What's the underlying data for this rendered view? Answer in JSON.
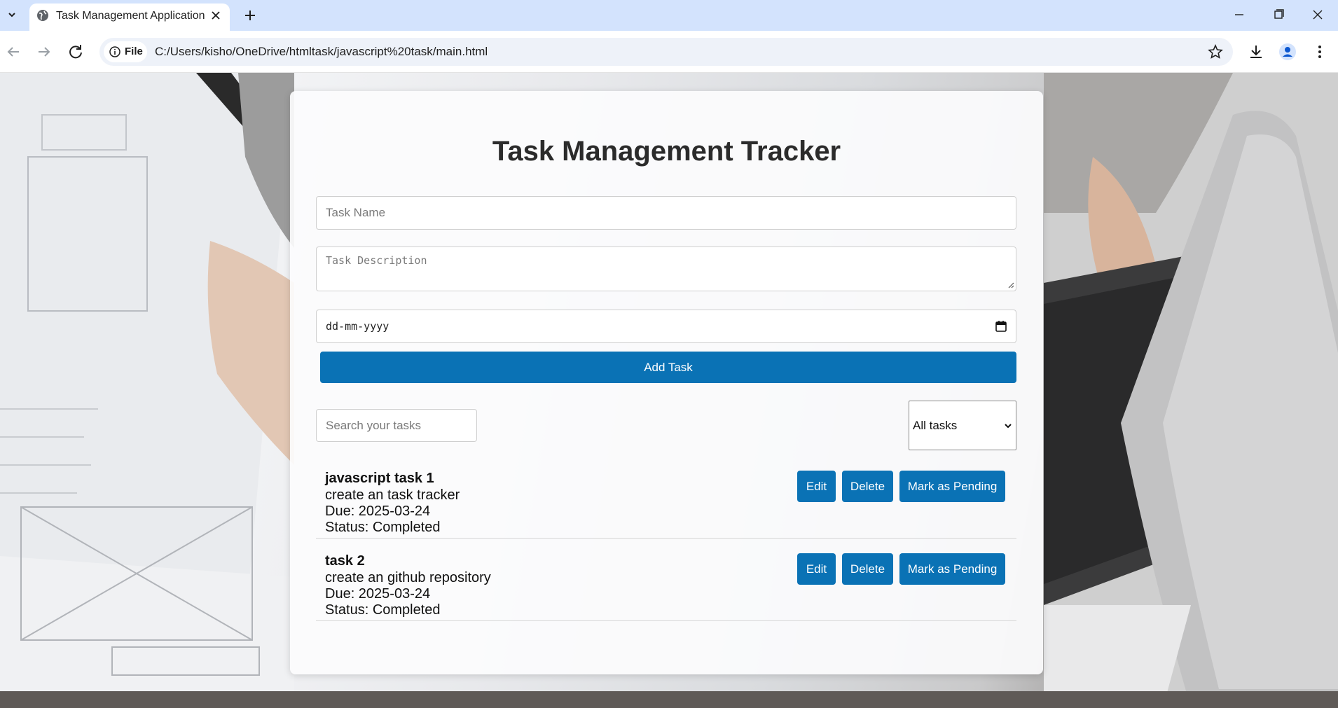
{
  "browser": {
    "tab_title": "Task Management Application",
    "chip_label": "File",
    "url": "C:/Users/kisho/OneDrive/htmltask/javascript%20task/main.html"
  },
  "page": {
    "title": "Task Management Tracker",
    "name_placeholder": "Task Name",
    "desc_placeholder": "Task Description",
    "date_value": "dd-mm-yyyy",
    "add_label": "Add Task",
    "search_placeholder": "Search your tasks",
    "filter_value": "All tasks"
  },
  "tasks": [
    {
      "name": "javascript task 1",
      "description": "create an task tracker",
      "due": "Due: 2025-03-24",
      "status": "Status: Completed",
      "edit_label": "Edit",
      "delete_label": "Delete",
      "toggle_label": "Mark as Pending"
    },
    {
      "name": "task 2",
      "description": "create an github repository",
      "due": "Due: 2025-03-24",
      "status": "Status: Completed",
      "edit_label": "Edit",
      "delete_label": "Delete",
      "toggle_label": "Mark as Pending"
    }
  ],
  "colors": {
    "primary_button": "#0a72b5",
    "tab_strip": "#d3e3fd"
  }
}
